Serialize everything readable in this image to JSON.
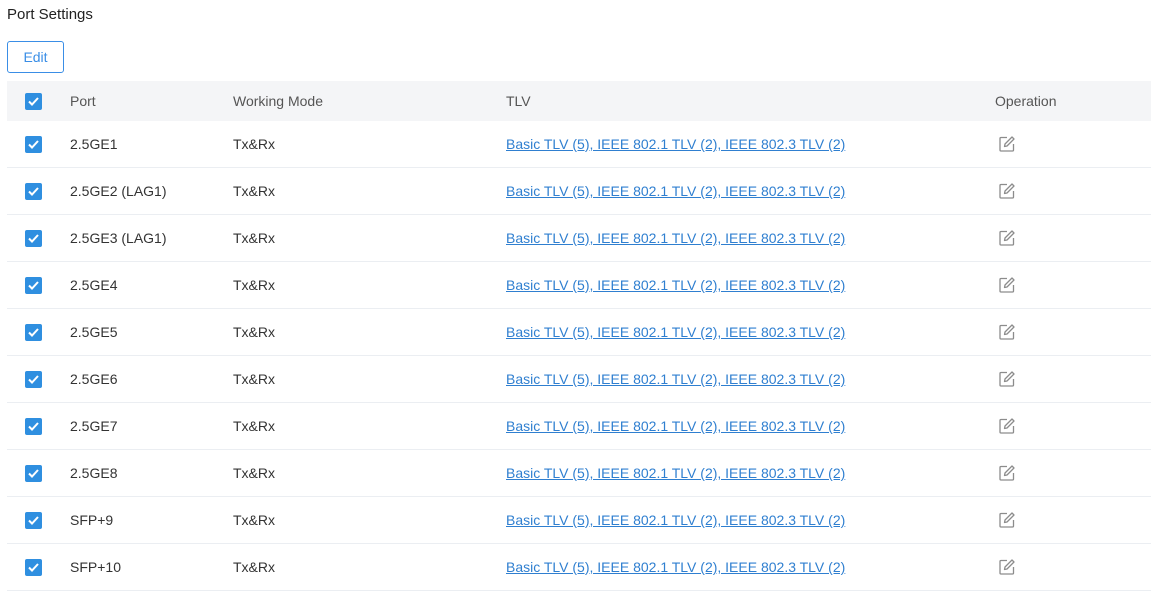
{
  "page": {
    "title": "Port Settings",
    "edit_label": "Edit"
  },
  "table": {
    "headers": {
      "port": "Port",
      "working_mode": "Working Mode",
      "tlv": "TLV",
      "operation": "Operation"
    },
    "select_all_checked": true,
    "rows": [
      {
        "checked": true,
        "port": "2.5GE1",
        "mode": "Tx&Rx",
        "tlv": "Basic TLV (5), IEEE 802.1 TLV (2), IEEE 802.3 TLV (2)"
      },
      {
        "checked": true,
        "port": "2.5GE2 (LAG1)",
        "mode": "Tx&Rx",
        "tlv": "Basic TLV (5), IEEE 802.1 TLV (2), IEEE 802.3 TLV (2)"
      },
      {
        "checked": true,
        "port": "2.5GE3 (LAG1)",
        "mode": "Tx&Rx",
        "tlv": "Basic TLV (5), IEEE 802.1 TLV (2), IEEE 802.3 TLV (2)"
      },
      {
        "checked": true,
        "port": "2.5GE4",
        "mode": "Tx&Rx",
        "tlv": "Basic TLV (5), IEEE 802.1 TLV (2), IEEE 802.3 TLV (2)"
      },
      {
        "checked": true,
        "port": "2.5GE5",
        "mode": "Tx&Rx",
        "tlv": "Basic TLV (5), IEEE 802.1 TLV (2), IEEE 802.3 TLV (2)"
      },
      {
        "checked": true,
        "port": "2.5GE6",
        "mode": "Tx&Rx",
        "tlv": "Basic TLV (5), IEEE 802.1 TLV (2), IEEE 802.3 TLV (2)"
      },
      {
        "checked": true,
        "port": "2.5GE7",
        "mode": "Tx&Rx",
        "tlv": "Basic TLV (5), IEEE 802.1 TLV (2), IEEE 802.3 TLV (2)"
      },
      {
        "checked": true,
        "port": "2.5GE8",
        "mode": "Tx&Rx",
        "tlv": "Basic TLV (5), IEEE 802.1 TLV (2), IEEE 802.3 TLV (2)"
      },
      {
        "checked": true,
        "port": "SFP+9",
        "mode": "Tx&Rx",
        "tlv": "Basic TLV (5), IEEE 802.1 TLV (2), IEEE 802.3 TLV (2)"
      },
      {
        "checked": true,
        "port": "SFP+10",
        "mode": "Tx&Rx",
        "tlv": "Basic TLV (5), IEEE 802.1 TLV (2), IEEE 802.3 TLV (2)"
      }
    ]
  },
  "icons": {
    "checkbox": "checkbox-checked-icon",
    "operation": "edit-icon"
  },
  "colors": {
    "accent": "#2f8fe0",
    "link": "#2f7fd0",
    "header_bg": "#f4f5f7",
    "icon": "#888888"
  }
}
